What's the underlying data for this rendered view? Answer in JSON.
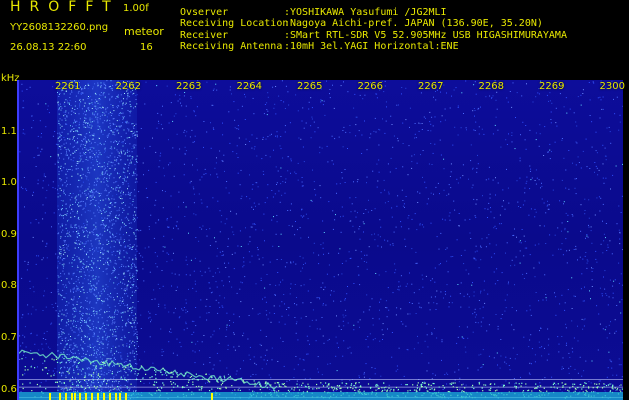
{
  "header": {
    "app_title": "HROFFT",
    "version": "1.00f",
    "filename": "YY2608132260.png",
    "datetime": "26.08.13 22:60",
    "meteor_label": "meteor",
    "meteor_count": "16",
    "info": [
      {
        "label": "Ovserver",
        "value": ":YOSHIKAWA Yasufumi /JG2MLI"
      },
      {
        "label": "Receiving Location",
        "value": ":Nagoya Aichi-pref. JAPAN (136.90E, 35.20N)"
      },
      {
        "label": "Receiver",
        "value": ":SMart RTL-SDR V5 52.905MHz USB HIGASHIMURAYAMA"
      },
      {
        "label": "Receiving Antenna",
        "value": ":10mH 3el.YAGI Horizontal:ENE"
      }
    ]
  },
  "colors": {
    "text": "#e8e800",
    "background_blue": "#0a0a8c",
    "echo_cyan": "#7fffd4",
    "marker_yellow": "#ffff00"
  },
  "chart_data": {
    "type": "heatmap",
    "yaxis_unit": "kHz",
    "ylim": [
      0.58,
      1.2
    ],
    "yticks": [
      "1.1",
      "1.0",
      "0.9",
      "0.8",
      "0.7",
      "0.6"
    ],
    "yticks_values": [
      1.1,
      1.0,
      0.9,
      0.8,
      0.7,
      0.6
    ],
    "xticks": [
      "2261",
      "2262",
      "2263",
      "2264",
      "2265",
      "2266",
      "2267",
      "2268",
      "2269",
      "2300"
    ],
    "xlim_minutes": [
      0,
      10
    ],
    "horizontal_reference_lines_khz": [
      0.62,
      0.605,
      0.585
    ]
  }
}
